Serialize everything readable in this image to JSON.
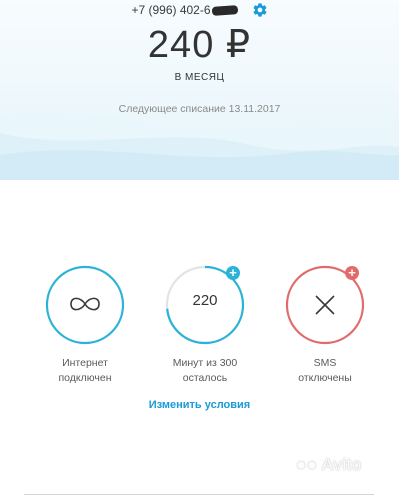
{
  "header": {
    "phone": "+7 (996) 402-6",
    "price": "240 ₽",
    "period": "В МЕСЯЦ",
    "next_charge": "Следующее списание 13.11.2017",
    "icon": "gear-icon"
  },
  "services": [
    {
      "name": "internet",
      "value": "",
      "label_line1": "Интернет",
      "label_line2": "подключен",
      "status": "unlimited",
      "icon": "infinity-icon",
      "color": "#2bb2d8",
      "badge": ""
    },
    {
      "name": "minutes",
      "value": "220",
      "label_line1": "Минут из 300",
      "label_line2": "осталось",
      "remaining_fraction": 0.733,
      "icon": "",
      "color": "#2bb2d8",
      "badge": "+"
    },
    {
      "name": "sms",
      "value": "",
      "label_line1": "SMS",
      "label_line2": "отключены",
      "status": "disabled",
      "icon": "close-icon",
      "color": "#e26a6a",
      "badge": "+"
    }
  ],
  "actions": {
    "change_terms": "Изменить условия"
  },
  "watermark": "Avito",
  "colors": {
    "accent": "#1a9bd6",
    "ring_active": "#2bb2d8",
    "ring_disabled": "#e26a6a",
    "ring_track": "#e3e3e3"
  }
}
